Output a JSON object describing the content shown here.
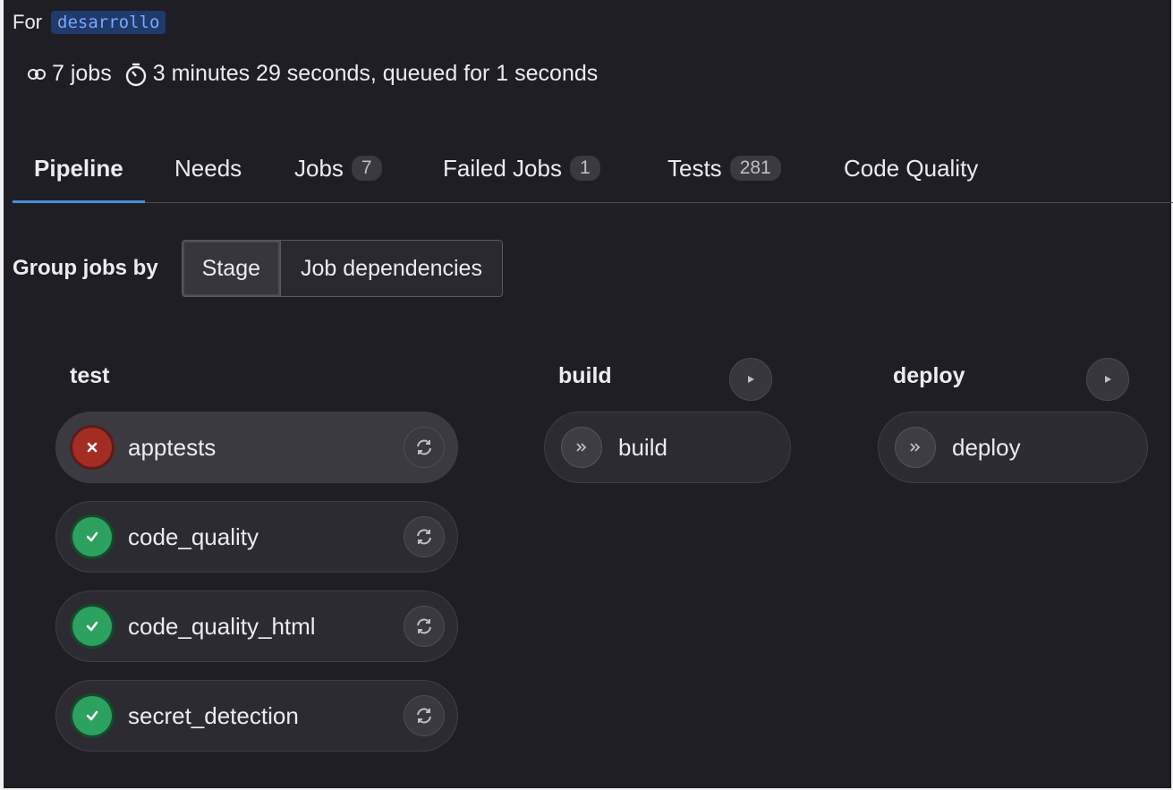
{
  "header": {
    "for_label": "For",
    "ref": "desarrollo",
    "jobs_count": "7 jobs",
    "duration": "3 minutes 29 seconds, queued for 1 seconds"
  },
  "tabs": [
    {
      "label": "Pipeline",
      "active": true
    },
    {
      "label": "Needs"
    },
    {
      "label": "Jobs",
      "count": "7"
    },
    {
      "label": "Failed Jobs",
      "count": "1"
    },
    {
      "label": "Tests",
      "count": "281"
    },
    {
      "label": "Code Quality"
    }
  ],
  "group_by": {
    "label": "Group jobs by",
    "options": [
      "Stage",
      "Job dependencies"
    ],
    "selected": "Stage"
  },
  "stages": [
    {
      "name": "test",
      "jobs": [
        {
          "name": "apptests",
          "status": "failed"
        },
        {
          "name": "code_quality",
          "status": "success"
        },
        {
          "name": "code_quality_html",
          "status": "success"
        },
        {
          "name": "secret_detection",
          "status": "success"
        }
      ]
    },
    {
      "name": "build",
      "jobs": [
        {
          "name": "build",
          "status": "manual"
        }
      ]
    },
    {
      "name": "deploy",
      "jobs": [
        {
          "name": "deploy",
          "status": "manual"
        }
      ]
    }
  ],
  "colors": {
    "accent": "#428fdc",
    "failed": "#a32c23",
    "success": "#2da160",
    "background": "#1f1e24"
  }
}
